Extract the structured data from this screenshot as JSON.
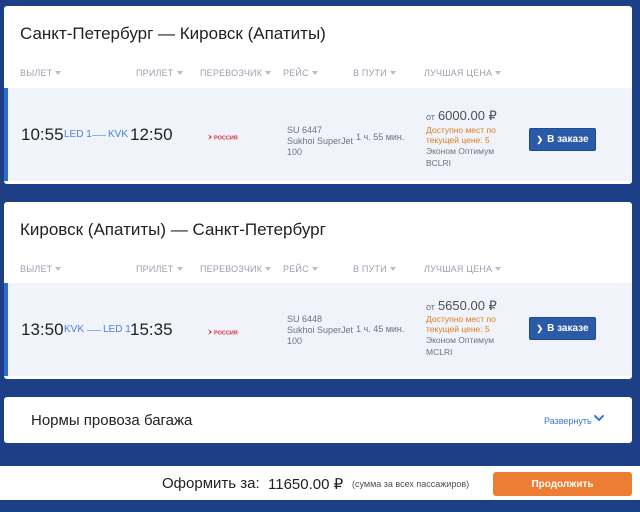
{
  "columns": {
    "depart": "ВЫЛЕТ",
    "arrive": "ПРИЛЕТ",
    "carrier": "ПЕРЕВОЗЧИК",
    "flight": "РЕЙС",
    "duration": "В ПУТИ",
    "best_price": "ЛУЧШАЯ ЦЕНА"
  },
  "segments": [
    {
      "title": "Санкт-Петербург — Кировск (Апатиты)",
      "dep_time": "10:55",
      "dep_code": "LED 1",
      "arr_code": "KVK",
      "arr_time": "12:50",
      "airline_logo_text": "РОССИЯ",
      "flight_no": "SU 6447",
      "aircraft_line1": "Sukhoi SuperJet",
      "aircraft_line2": "100",
      "duration": "1 ч. 55 мин.",
      "price_prefix": "от",
      "price": "6000.00 ₽",
      "avail_line1": "Доступно мест по",
      "avail_line2": "текущей цене: 5",
      "fare_name": "Эконом Оптимум",
      "fare_code": "BCLRI",
      "book_label": "В заказе"
    },
    {
      "title": "Кировск (Апатиты) — Санкт-Петербург",
      "dep_time": "13:50",
      "dep_code": "KVK",
      "arr_code": "LED 1",
      "arr_time": "15:35",
      "airline_logo_text": "РОССИЯ",
      "flight_no": "SU 6448",
      "aircraft_line1": "Sukhoi SuperJet",
      "aircraft_line2": "100",
      "duration": "1 ч. 45 мин.",
      "price_prefix": "от",
      "price": "5650.00 ₽",
      "avail_line1": "Доступно мест по",
      "avail_line2": "текущей цене: 5",
      "fare_name": "Эконом Оптимум",
      "fare_code": "MCLRI",
      "book_label": "В заказе"
    }
  ],
  "baggage": {
    "title": "Нормы провоза багажа",
    "expand_label": "Развернуть"
  },
  "footer": {
    "total_label": "Оформить за:",
    "total_value": "11650.00 ₽",
    "total_note": "(сумма за всех пассажиров)",
    "continue_label": "Продолжить"
  },
  "colors": {
    "page_bg": "#1c3f86",
    "accent_blue": "#2a5aa8",
    "orange": "#ec7d33",
    "logo_red": "#d32f2f"
  }
}
